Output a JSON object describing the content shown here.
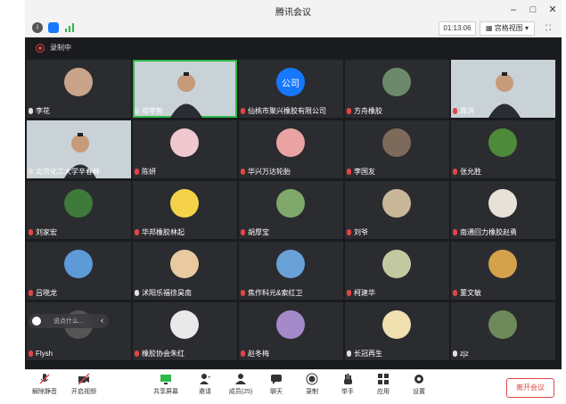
{
  "window": {
    "title": "腾讯会议"
  },
  "infobar": {
    "timer": "01:13:06",
    "view_label": "宫格视图"
  },
  "recording": {
    "label": "录制中"
  },
  "participants": [
    {
      "name": "李花",
      "muted": false
    },
    {
      "name": "祁宇智",
      "muted": false
    },
    {
      "name": "仙桃市聚兴橡胶有限公司",
      "muted": true
    },
    {
      "name": "方舟橡胶",
      "muted": true
    },
    {
      "name": "周洪",
      "muted": true
    },
    {
      "name": "北京化工大学辛春林",
      "muted": false
    },
    {
      "name": "陈妍",
      "muted": true
    },
    {
      "name": "华兴万达轮胎",
      "muted": true
    },
    {
      "name": "李国友",
      "muted": true
    },
    {
      "name": "张允胜",
      "muted": true
    },
    {
      "name": "刘家宏",
      "muted": true
    },
    {
      "name": "华邦橡胶林起",
      "muted": true
    },
    {
      "name": "胡厚宝",
      "muted": true
    },
    {
      "name": "刘爷",
      "muted": true
    },
    {
      "name": "南通回力橡胶赵勇",
      "muted": true
    },
    {
      "name": "吕晓龙",
      "muted": true
    },
    {
      "name": "沭阳乐福徐昊南",
      "muted": false
    },
    {
      "name": "焦作科元&索红卫",
      "muted": true
    },
    {
      "name": "柯建华",
      "muted": true
    },
    {
      "name": "董文敏",
      "muted": true
    },
    {
      "name": "Flysh",
      "muted": true
    },
    {
      "name": "橡胶协会朱红",
      "muted": true
    },
    {
      "name": "赵冬梅",
      "muted": true
    },
    {
      "name": "长冠再生",
      "muted": false
    },
    {
      "name": "zjz",
      "muted": false
    }
  ],
  "company_badge": "公司",
  "chat": {
    "placeholder": "说点什么..."
  },
  "toolbar": {
    "mute": "解除静音",
    "video": "开启视频",
    "share": "共享屏幕",
    "invite": "邀请",
    "members": "成员(25)",
    "chat": "聊天",
    "record": "录制",
    "raise_hand": "举手",
    "apps": "应用",
    "settings": "设置",
    "leave": "离开会议"
  },
  "colors": {
    "accent": "#1677ff",
    "danger": "#e34545",
    "tile_bg": "#2b2c30",
    "window_bg": "#1a1b1e"
  }
}
